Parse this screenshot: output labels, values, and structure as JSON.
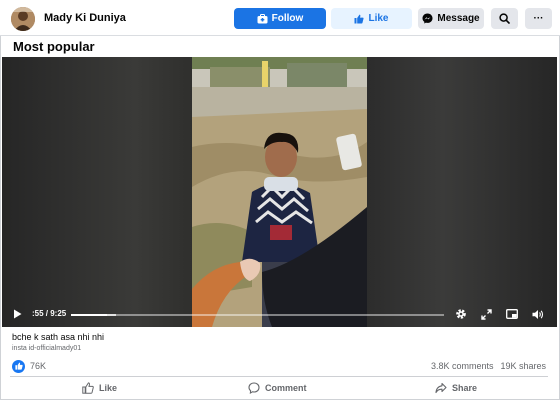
{
  "header": {
    "page_name": "Mady Ki Duniya",
    "follow_label": "Follow",
    "like_label": "Like",
    "message_label": "Message",
    "more_label": "···"
  },
  "section": {
    "title": "Most popular"
  },
  "video": {
    "time_display": ":55 / 9:25",
    "progress_fraction": 0.097,
    "buffered_fraction": 0.12
  },
  "post": {
    "caption": "bche k sath asa nhi nhi",
    "subcaption": "insta id-officialmady01",
    "reaction_count": "76K",
    "comments_count": "3.8K comments",
    "shares_count": "19K shares"
  },
  "actions": {
    "like_label": "Like",
    "comment_label": "Comment",
    "share_label": "Share"
  },
  "colors": {
    "brand_blue": "#1b74e4",
    "like_bg": "#e7f3ff",
    "neutral_button": "#e4e6eb",
    "secondary_text": "#65676b"
  },
  "icons": {
    "follow": "follow-icon",
    "like": "thumbs-up-icon",
    "message": "messenger-icon",
    "search": "search-icon",
    "play": "play-icon",
    "settings": "gear-icon",
    "fullscreen": "fullscreen-icon",
    "pip": "picture-in-picture-icon",
    "volume": "volume-icon",
    "comment": "comment-icon",
    "share": "share-icon"
  }
}
